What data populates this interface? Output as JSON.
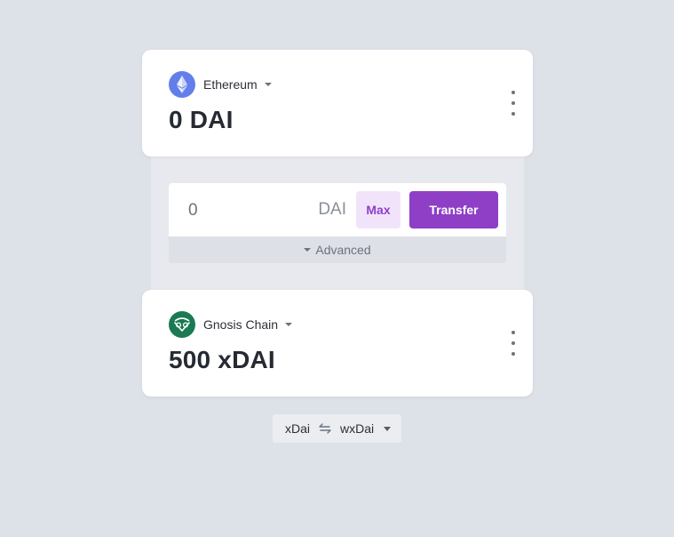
{
  "source": {
    "chain_name": "Ethereum",
    "chain_icon": "ethereum-icon",
    "balance": "0 DAI"
  },
  "transfer": {
    "amount_placeholder": "0",
    "unit": "DAI",
    "max_label": "Max",
    "transfer_label": "Transfer",
    "advanced_label": "Advanced"
  },
  "destination": {
    "chain_name": "Gnosis Chain",
    "chain_icon": "gnosis-icon",
    "balance": "500 xDAI"
  },
  "token_switch": {
    "from": "xDai",
    "to": "wxDai",
    "icon": "swap-arrows-icon"
  },
  "colors": {
    "background": "#dde1e8",
    "accent": "#8e3fc6",
    "accent_light": "#f1e4fa",
    "ethereum": "#627eea",
    "gnosis": "#1a7a52"
  }
}
